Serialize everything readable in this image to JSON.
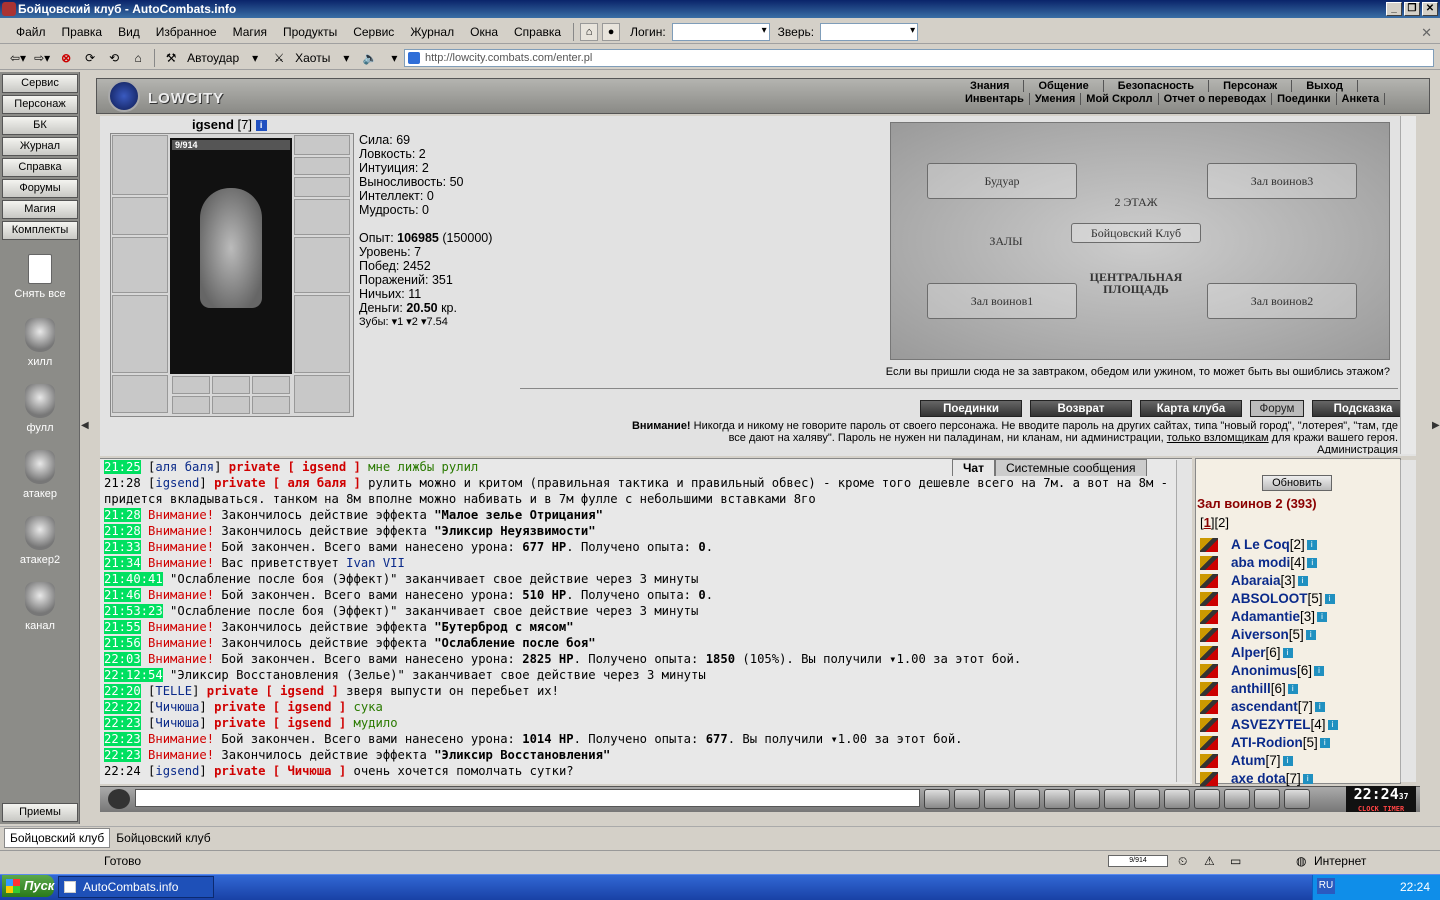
{
  "window": {
    "title": "Бойцовский клуб - AutoCombats.info"
  },
  "menu": {
    "items": [
      "Файл",
      "Правка",
      "Вид",
      "Избранное",
      "Магия",
      "Продукты",
      "Сервис",
      "Журнал",
      "Окна",
      "Справка"
    ],
    "login_label": "Логин:",
    "beast_label": "Зверь:"
  },
  "toolbar": {
    "autoudar": "Автоудар",
    "haoty": "Хаоты"
  },
  "address": {
    "url": "http://lowcity.combats.com/enter.pl"
  },
  "sidebar": {
    "buttons": [
      "Сервис",
      "Персонаж",
      "БК",
      "Журнал",
      "Справка",
      "Форумы",
      "Магия",
      "Комплекты"
    ],
    "kits": [
      "Снять все",
      "хилл",
      "фулл",
      "атакер",
      "атакер2",
      "канал"
    ],
    "bottom_button": "Приемы"
  },
  "header": {
    "logo_text": "LOWCITY",
    "nav_top": [
      "Знания",
      "Общение",
      "Безопасность",
      "Персонаж",
      "Выход"
    ],
    "nav_bottom": [
      "Инвентарь",
      "Умения",
      "Мой Скролл",
      "Отчет о переводах",
      "Поединки",
      "Анкета"
    ]
  },
  "character": {
    "name": "igsend",
    "level": "[7]",
    "hp": "9/914",
    "stats": [
      "Сила: 69",
      "Ловкость: 2",
      "Интуиция: 2",
      "Выносливость: 50",
      "Интеллект: 0",
      "Мудрость: 0"
    ],
    "exp_label": "Опыт: ",
    "exp_value": "106985",
    "exp_next": " (150000)",
    "level_line": "Уровень: 7",
    "wins": "Побед: 2452",
    "losses": "Поражений: 351",
    "draws": "Ничьих: 11",
    "money_label": "Деньги: ",
    "money_value": "20.50",
    "money_unit": " кр.",
    "teeth": "Зубы: ▾1 ▾2 ▾7.54"
  },
  "map": {
    "rooms": [
      "Будуар",
      "Зал воинов3",
      "ЗАЛЫ",
      "Зал воинов1",
      "Зал воинов2"
    ],
    "center_top": "2 ЭТАЖ",
    "center_mid": "Бойцовский Клуб",
    "center_bottom": "ЦЕНТРАЛЬНАЯ ПЛОЩАДЬ",
    "note": "Если вы пришли сюда не за завтраком, обедом или ужином, то может быть вы ошиблись этажом?"
  },
  "location_buttons": [
    "Поединки",
    "Возврат",
    "Карта клуба",
    "Форум",
    "Подсказка"
  ],
  "warning": {
    "bold": "Внимание!",
    "text1": " Никогда и никому не говорите пароль от своего персонажа. Не вводите пароль на других сайтах, типа \"новый город\", \"лотерея\", \"там, где",
    "text2": "все дают на халяву\". Пароль не нужен ни паладинам, ни кланам, ни администрации, ",
    "link": "только взломщикам",
    "text3": " для кражи вашего героя.",
    "text4": "Администрация"
  },
  "chat": {
    "tabs": [
      "Чат",
      "Системные сообщения"
    ],
    "lines": [
      [
        [
          "tg",
          "21:25"
        ],
        [
          "tp",
          " ["
        ],
        [
          "nm",
          "аля баля"
        ],
        [
          "tp",
          "] "
        ],
        [
          "pv",
          "private [ igsend ]"
        ],
        [
          "gm",
          " мне лижбы рулил"
        ]
      ],
      [
        [
          "tp",
          "21:28 ["
        ],
        [
          "nm",
          "igsend"
        ],
        [
          "tp",
          "] "
        ],
        [
          "pv",
          "private [ аля баля ]"
        ],
        [
          "tp",
          " рулить можно и критом (правильная тактика и правильный обвес) - кроме того дешевле всего на 7м. а вот на 8м -"
        ]
      ],
      [
        [
          "tp",
          "придется вкладываться. танком на 8м вполне можно набивать и в 7м фулле с небольшими вставками 8го"
        ]
      ],
      [
        [
          "tg",
          "21:28"
        ],
        [
          "wr",
          " Внимание!"
        ],
        [
          "tp",
          " Закончилось действие эффекта "
        ],
        [
          "bd",
          "\"Малое зелье Отрицания\""
        ]
      ],
      [
        [
          "tg",
          "21:28"
        ],
        [
          "wr",
          " Внимание!"
        ],
        [
          "tp",
          " Закончилось действие эффекта "
        ],
        [
          "bd",
          "\"Эликсир Неуязвимости\""
        ]
      ],
      [
        [
          "tg",
          "21:33"
        ],
        [
          "wr",
          " Внимание!"
        ],
        [
          "tp",
          " Бой закончен. Всего вами нанесено урона: "
        ],
        [
          "bd",
          "677 HP"
        ],
        [
          "tp",
          ". Получено опыта: "
        ],
        [
          "bd",
          "0"
        ],
        [
          "tp",
          "."
        ]
      ],
      [
        [
          "tg",
          "21:34"
        ],
        [
          "wr",
          " Внимание!"
        ],
        [
          "tp",
          " Вас приветствует "
        ],
        [
          "nm",
          "Ivan VII"
        ]
      ],
      [
        [
          "tg",
          "21:40:41"
        ],
        [
          "tp",
          " \"Ослабление после боя (Эффект)\" заканчивает свое действие через 3 минуты"
        ]
      ],
      [
        [
          "tg",
          "21:46"
        ],
        [
          "wr",
          " Внимание!"
        ],
        [
          "tp",
          " Бой закончен. Всего вами нанесено урона: "
        ],
        [
          "bd",
          "510 HP"
        ],
        [
          "tp",
          ". Получено опыта: "
        ],
        [
          "bd",
          "0"
        ],
        [
          "tp",
          "."
        ]
      ],
      [
        [
          "tg",
          "21:53:23"
        ],
        [
          "tp",
          " \"Ослабление после боя (Эффект)\" заканчивает свое действие через 3 минуты"
        ]
      ],
      [
        [
          "tg",
          "21:55"
        ],
        [
          "wr",
          " Внимание!"
        ],
        [
          "tp",
          " Закончилось действие эффекта "
        ],
        [
          "bd",
          "\"Бутерброд с мясом\""
        ]
      ],
      [
        [
          "tg",
          "21:56"
        ],
        [
          "wr",
          " Внимание!"
        ],
        [
          "tp",
          " Закончилось действие эффекта "
        ],
        [
          "bd",
          "\"Ослабление после боя\""
        ]
      ],
      [
        [
          "tg",
          "22:03"
        ],
        [
          "wr",
          " Внимание!"
        ],
        [
          "tp",
          " Бой закончен. Всего вами нанесено урона: "
        ],
        [
          "bd",
          "2825 HP"
        ],
        [
          "tp",
          ". Получено опыта: "
        ],
        [
          "bd",
          "1850"
        ],
        [
          "tp",
          " (105%). Вы получили ▾1.00 за этот бой."
        ]
      ],
      [
        [
          "tg",
          "22:12:54"
        ],
        [
          "tp",
          " \"Эликсир Восстановления (Зелье)\" заканчивает свое действие через 3 минуты"
        ]
      ],
      [
        [
          "tg",
          "22:20"
        ],
        [
          "tp",
          " ["
        ],
        [
          "nm",
          "TELLE"
        ],
        [
          "tp",
          "] "
        ],
        [
          "pv",
          "private [ igsend ]"
        ],
        [
          "tp",
          " зверя выпусти он перебьет их!"
        ]
      ],
      [
        [
          "tg",
          "22:22"
        ],
        [
          "tp",
          " ["
        ],
        [
          "nm",
          "Чичюша"
        ],
        [
          "tp",
          "] "
        ],
        [
          "pv",
          "private [ igsend ]"
        ],
        [
          "gm",
          " сука"
        ]
      ],
      [
        [
          "tg",
          "22:23"
        ],
        [
          "tp",
          " ["
        ],
        [
          "nm",
          "Чичюша"
        ],
        [
          "tp",
          "] "
        ],
        [
          "pv",
          "private [ igsend ]"
        ],
        [
          "gm",
          " мудило"
        ]
      ],
      [
        [
          "tg",
          "22:23"
        ],
        [
          "wr",
          " Внимание!"
        ],
        [
          "tp",
          " Бой закончен. Всего вами нанесено урона: "
        ],
        [
          "bd",
          "1014 HP"
        ],
        [
          "tp",
          ". Получено опыта: "
        ],
        [
          "bd",
          "677"
        ],
        [
          "tp",
          ". Вы получили ▾1.00 за этот бой."
        ]
      ],
      [
        [
          "tg",
          "22:23"
        ],
        [
          "wr",
          " Внимание!"
        ],
        [
          "tp",
          " Закончилось действие эффекта "
        ],
        [
          "bd",
          "\"Эликсир Восстановления\""
        ]
      ],
      [
        [
          "tp",
          "22:24 ["
        ],
        [
          "nm",
          "igsend"
        ],
        [
          "tp",
          "] "
        ],
        [
          "pv",
          "private [ Чичюша ]"
        ],
        [
          "tp",
          " очень хочется помолчать сутки?"
        ]
      ]
    ]
  },
  "online": {
    "refresh": "Обновить",
    "room": "Зал воинов 2 (393)",
    "pages": [
      "1",
      "2"
    ],
    "players": [
      {
        "name": "A Le Coq",
        "level": "[2]"
      },
      {
        "name": "aba modi",
        "level": "[4]"
      },
      {
        "name": "Abaraia",
        "level": "[3]"
      },
      {
        "name": "ABSOLOOT",
        "level": "[5]"
      },
      {
        "name": "Adamantie",
        "level": "[3]"
      },
      {
        "name": "Aiverson",
        "level": "[5]"
      },
      {
        "name": "Alper",
        "level": "[6]"
      },
      {
        "name": "Anonimus",
        "level": "[6]"
      },
      {
        "name": "anthill",
        "level": "[6]"
      },
      {
        "name": "ascendant",
        "level": "[7]"
      },
      {
        "name": "ASVEZYTEL",
        "level": "[4]"
      },
      {
        "name": "ATI-Rodion",
        "level": "[5]"
      },
      {
        "name": "Atum",
        "level": "[7]"
      },
      {
        "name": "axe dota",
        "level": "[7]"
      }
    ]
  },
  "clock": {
    "time": "22:24",
    "sec": "37",
    "labels": "CLOCK TIMER"
  },
  "bottom_tabs": [
    "Бойцовский клуб",
    "Бойцовский клуб"
  ],
  "status": {
    "ready": "Готово",
    "progress": "9/914",
    "zone": "Интернет"
  },
  "taskbar": {
    "start": "Пуск",
    "item": "AutoCombats.info",
    "lang": "RU",
    "time": "22:24"
  },
  "colors": {
    "timestamp_green": "#00e060",
    "private_red": "#d00000",
    "name_blue": "#0a2a8a"
  }
}
